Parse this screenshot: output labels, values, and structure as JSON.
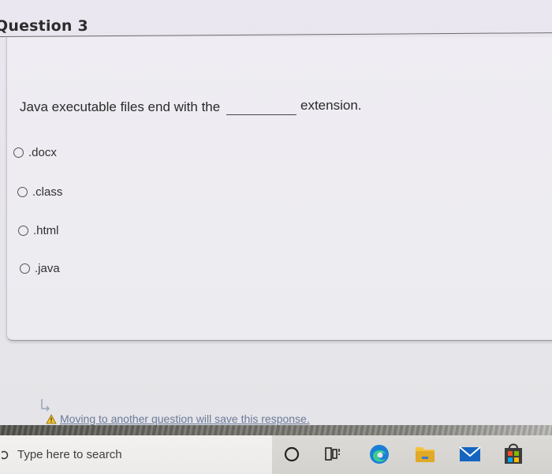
{
  "question": {
    "title": "Question 3",
    "text_before": "Java executable files end with the",
    "text_after": "extension."
  },
  "options": [
    {
      "label": ".docx",
      "selected": false
    },
    {
      "label": ".class",
      "selected": false
    },
    {
      "label": ".html",
      "selected": false
    },
    {
      "label": ".java",
      "selected": false
    }
  ],
  "notice": {
    "text": "Moving to another question will save this response.",
    "icon": "warning-icon"
  },
  "taskbar": {
    "search_placeholder": "Type here to search",
    "icons": [
      "cortana-icon",
      "task-view-icon",
      "edge-icon",
      "file-explorer-icon",
      "mail-icon",
      "store-icon"
    ]
  },
  "colors": {
    "edge_blue": "#1b7fd6",
    "explorer_yellow": "#f3c23d",
    "mail_blue": "#1565c0",
    "warning_yellow": "#f2c230"
  }
}
